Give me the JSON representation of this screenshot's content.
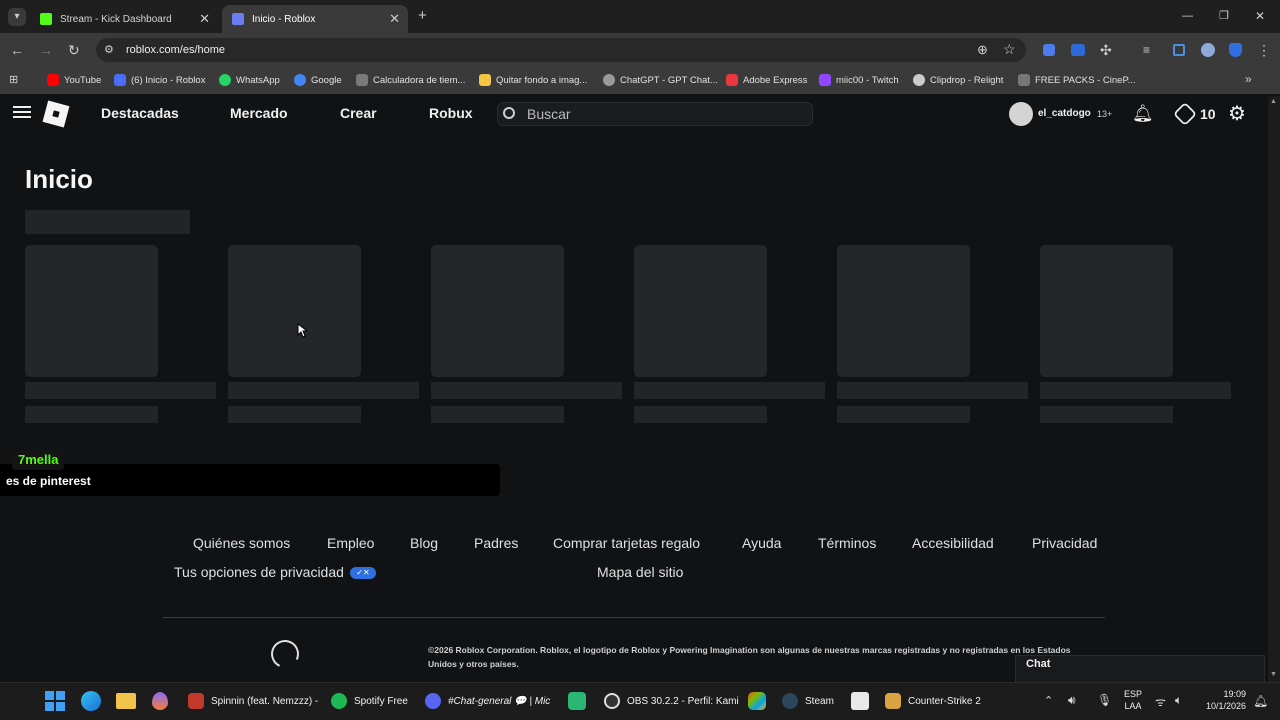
{
  "browser": {
    "tabs": [
      {
        "title": "Stream - Kick Dashboard",
        "active": false
      },
      {
        "title": "Inicio - Roblox",
        "active": true
      }
    ],
    "new_tab": "+",
    "url": "roblox.com/es/home",
    "window_controls": {
      "minimize": "—",
      "maximize": "❐",
      "close": "✕"
    },
    "bookmarks": [
      {
        "label": "YouTube",
        "color": "#ff0000"
      },
      {
        "label": "(6) Inicio - Roblox",
        "color": "#4a6cf7"
      },
      {
        "label": "WhatsApp",
        "color": "#25d366"
      },
      {
        "label": "Google",
        "color": "#4285f4"
      },
      {
        "label": "Calculadora de tiem...",
        "color": "#7a7a7a"
      },
      {
        "label": "Quitar fondo a imag...",
        "color": "#f4c542"
      },
      {
        "label": "ChatGPT - GPT Chat...",
        "color": "#9a9a9a"
      },
      {
        "label": "Adobe Express",
        "color": "#e8383d"
      },
      {
        "label": "miic00 - Twitch",
        "color": "#9146ff"
      },
      {
        "label": "Clipdrop - Relight",
        "color": "#cccccc"
      },
      {
        "label": "FREE PACKS - CineP...",
        "color": "#777777"
      }
    ]
  },
  "header": {
    "nav": [
      "Destacadas",
      "Mercado",
      "Crear",
      "Robux"
    ],
    "search_placeholder": "Buscar",
    "username": "el_catdogo",
    "age_badge": "13+",
    "robux_count": "10"
  },
  "main": {
    "title": "Inicio"
  },
  "overlay": {
    "user": "7mella",
    "message": "es de pinterest"
  },
  "footer": {
    "links": [
      "Quiénes somos",
      "Empleo",
      "Blog",
      "Padres",
      "Comprar tarjetas regalo",
      "Ayuda",
      "Términos",
      "Accesibilidad",
      "Privacidad"
    ],
    "privacy_choices": "Tus opciones de privacidad",
    "sitemap": "Mapa del sitio",
    "copyright": "©2026 Roblox Corporation. Roblox, el logotipo de Roblox y Powering Imagination son algunas de nuestras marcas registradas y no registradas en los Estados Unidos y otros países.",
    "chat_label": "Chat"
  },
  "taskbar": {
    "apps": [
      {
        "label": "Spinnin (feat. Nemzzz) -",
        "color": "#c0392b"
      },
      {
        "label": "Spotify Free",
        "color": "#1db954"
      },
      {
        "label": "#Chat-general 💬 | Mic",
        "color": "#5865f2"
      },
      {
        "label": "OBS 30.2.2 - Perfil: Kami",
        "color": "#444444"
      },
      {
        "label": "Steam",
        "color": "#1b2838"
      },
      {
        "label": "Counter-Strike 2",
        "color": "#d9a441"
      }
    ],
    "lang": "ESP",
    "lang_sub": "LAA",
    "time": "19:09",
    "date": "10/1/2026"
  }
}
